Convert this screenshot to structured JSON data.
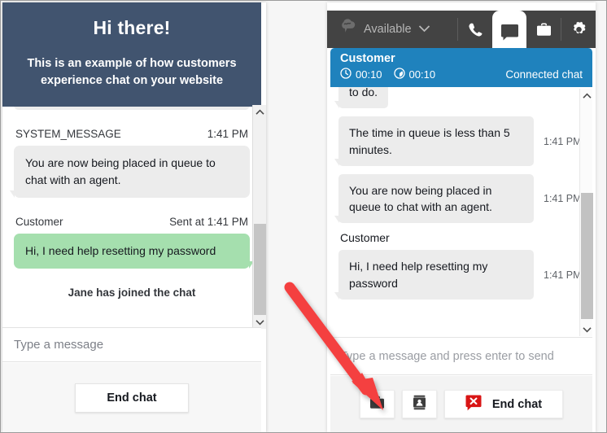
{
  "customer_widget": {
    "header": {
      "title": "Hi there!",
      "subtitle": "This is an example of how customers experience chat on your website"
    },
    "messages": [
      {
        "sender": "SYSTEM_MESSAGE",
        "time_label": "",
        "time": "1:41 PM",
        "text": "You are now being placed in queue to chat with an agent.",
        "kind": "system"
      },
      {
        "sender": "Customer",
        "time_label": "Sent at",
        "time": "1:41 PM",
        "text": "Hi, I need help resetting my password",
        "kind": "customer"
      }
    ],
    "system_note": "Jane has joined the chat",
    "input_placeholder": "Type a message",
    "end_chat_label": "End chat",
    "scrollbar": {
      "up_icon": "chevron-up-icon",
      "down_icon": "chevron-down-icon"
    }
  },
  "agent_ccp": {
    "topbar": {
      "connect_icon": "amazon-connect-cloud-icon",
      "status": "Available",
      "status_chevron_icon": "chevron-down-icon",
      "tabs": [
        {
          "name": "phone-tab",
          "icon": "phone-icon",
          "active": false
        },
        {
          "name": "chat-tab",
          "icon": "chat-bubble-icon",
          "active": true
        },
        {
          "name": "tasks-tab",
          "icon": "briefcase-icon",
          "active": false
        }
      ],
      "settings_icon": "gear-icon"
    },
    "contact_header": {
      "name": "Customer",
      "timers": [
        {
          "icon": "clock-icon",
          "value": "00:10"
        },
        {
          "icon": "stopwatch-icon",
          "value": "00:10"
        }
      ],
      "state": "Connected chat",
      "accent_color": "#1f82bd"
    },
    "messages": [
      {
        "text": "to do.",
        "time": "",
        "kind": "system",
        "clipped": true
      },
      {
        "text": "The time in queue is less than 5 minutes.",
        "time": "1:41 PM",
        "kind": "system",
        "clipped": false
      },
      {
        "text": "You are now being placed in queue to chat with an agent.",
        "time": "1:41 PM",
        "kind": "system",
        "clipped": false
      }
    ],
    "customer_block": {
      "name": "Customer",
      "text": "Hi, I need help resetting my password",
      "time": "1:41 PM"
    },
    "input_placeholder": "Type a message and press enter to send",
    "actions": [
      {
        "name": "quick-connects-button",
        "icon": "briefcase-icon",
        "label": ""
      },
      {
        "name": "contact-attributes-button",
        "icon": "contact-card-icon",
        "label": ""
      },
      {
        "name": "end-chat-button",
        "icon": "end-chat-icon",
        "label": "End chat"
      }
    ],
    "scrollbar": {
      "up_icon": "chevron-up-icon",
      "down_icon": "chevron-down-icon"
    }
  },
  "annotation": {
    "arrow_color": "#f43f3f",
    "points_at": "quick-connects-button"
  },
  "colors": {
    "widget_header": "#41546f",
    "customer_bubble": "#a5dfae",
    "system_bubble": "#ececec",
    "ccp_topbar": "#434343",
    "contact_accent": "#1f82bd",
    "end_chat_red": "#d91515"
  }
}
